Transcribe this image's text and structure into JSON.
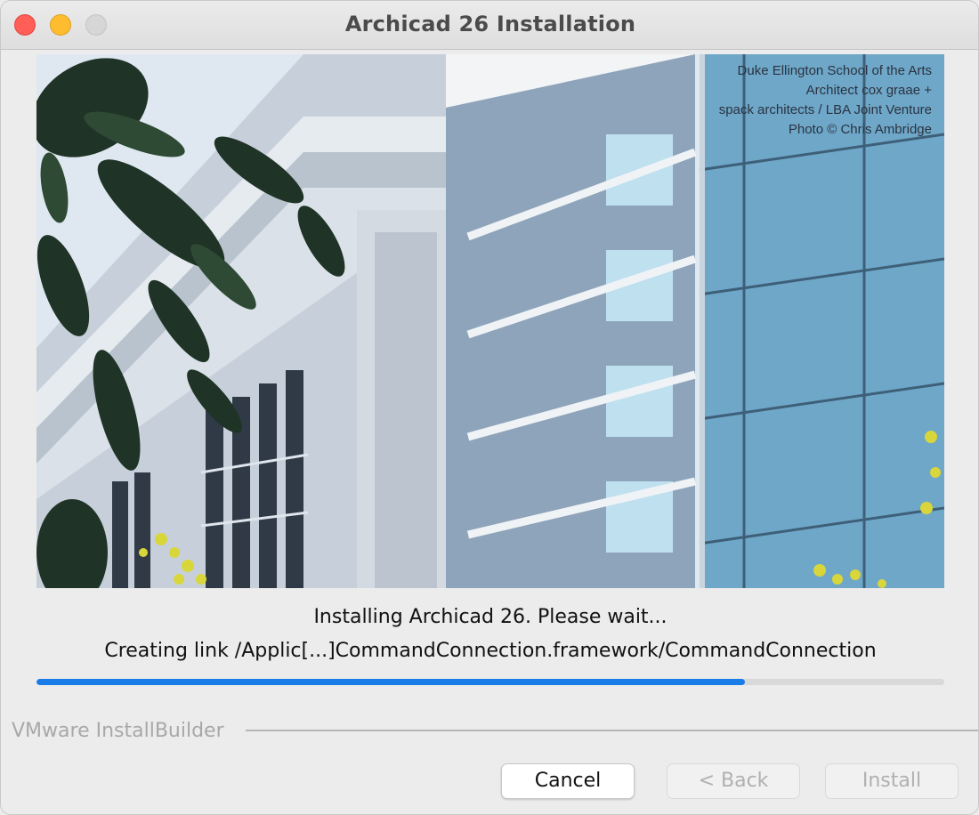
{
  "window": {
    "title": "Archicad 26 Installation"
  },
  "banner": {
    "caption": [
      "Duke Ellington School of the Arts",
      "Architect cox graae +",
      "spack architects / LBA Joint Venture",
      "Photo © Chris Ambridge"
    ]
  },
  "status": {
    "line1": "Installing Archicad 26. Please wait...",
    "line2": "Creating link /Applic[...]CommandConnection.framework/CommandConnection"
  },
  "progress": {
    "fraction": 0.78,
    "color": "#1a7ce8"
  },
  "footer": {
    "brand": "VMware InstallBuilder"
  },
  "buttons": {
    "cancel": "Cancel",
    "back": "< Back",
    "install": "Install"
  }
}
